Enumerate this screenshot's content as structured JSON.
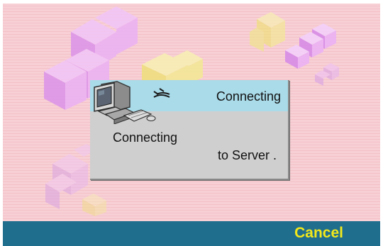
{
  "dialog": {
    "title": "Connecting",
    "message_line1": "Connecting",
    "message_line2": "to Server ."
  },
  "softkeys": {
    "right_label": "Cancel"
  },
  "icons": {
    "dialog_icon": "computer-icon",
    "signal": "connection-waves-icon",
    "background": "tetromino-blocks"
  },
  "colors": {
    "background_pink": "#f6cdd2",
    "dialog_header": "#a9dbe9",
    "dialog_body": "#cfcfcf",
    "softkey_bar": "#1f6e8e",
    "softkey_text": "#f3e81a",
    "block_purple": "#e6a4ef",
    "block_yellow": "#f4ea8f"
  }
}
